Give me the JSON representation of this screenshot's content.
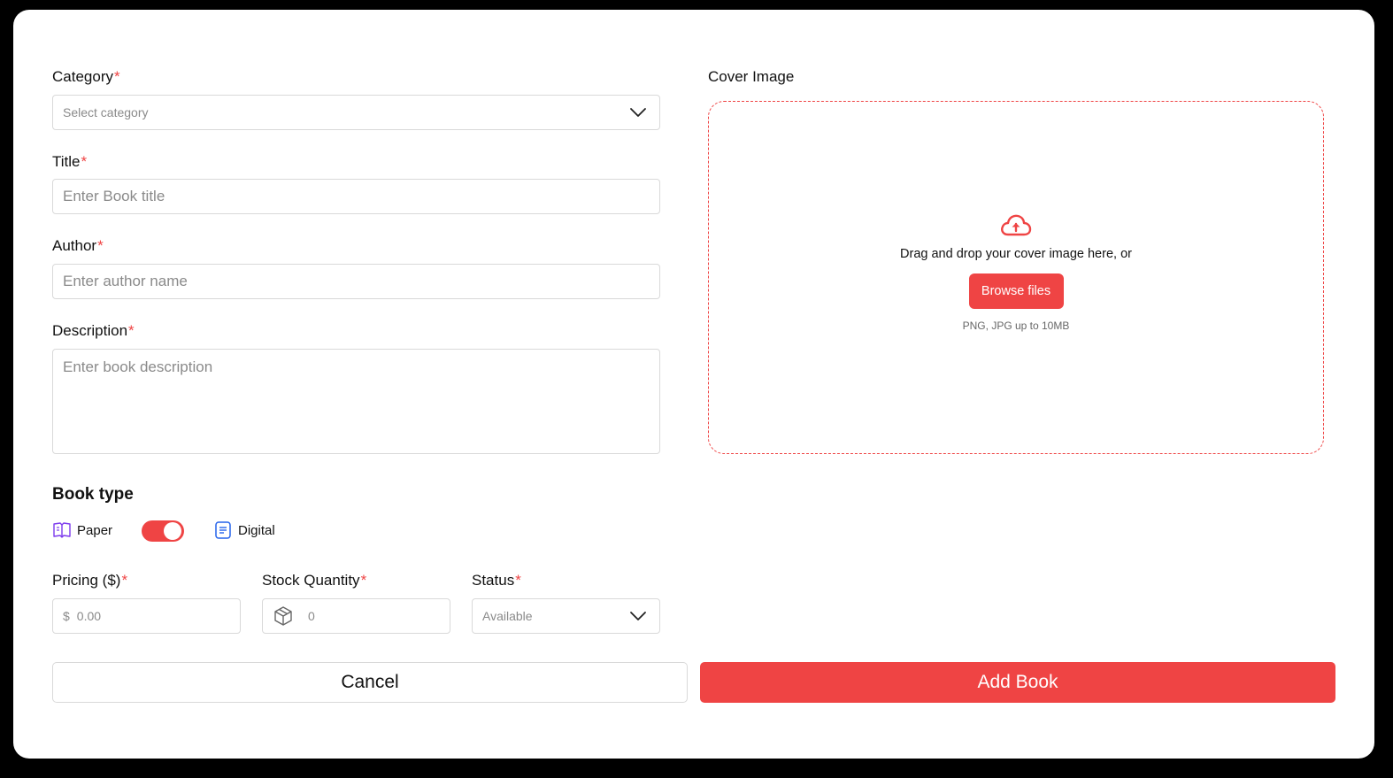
{
  "form": {
    "category": {
      "label": "Category",
      "required": "*",
      "placeholder": "Select category"
    },
    "title": {
      "label": "Title",
      "required": "*",
      "placeholder": "Enter Book title"
    },
    "author": {
      "label": "Author",
      "required": "*",
      "placeholder": "Enter author name"
    },
    "description": {
      "label": "Description",
      "required": "*",
      "placeholder": "Enter book description"
    },
    "book_type": {
      "label": "Book type",
      "paper_label": "Paper",
      "digital_label": "Digital",
      "toggle_on": true
    },
    "pricing": {
      "label": "Pricing ($)",
      "required": "*",
      "prefix": "$",
      "placeholder": "0.00"
    },
    "stock": {
      "label": "Stock Quantity",
      "required": "*",
      "placeholder": "0"
    },
    "status": {
      "label": "Status",
      "required": "*",
      "value": "Available"
    }
  },
  "cover": {
    "label": "Cover Image",
    "drop_text": "Drag and drop your cover image here, or",
    "browse_label": "Browse files",
    "hint": "PNG, JPG up to 10MB"
  },
  "actions": {
    "cancel_label": "Cancel",
    "add_label": "Add Book"
  },
  "colors": {
    "accent": "#ef4444",
    "paper_icon": "#7c3aed",
    "digital_icon": "#2563eb"
  },
  "icons": [
    "chevron-down-icon",
    "cloud-upload-icon",
    "book-open-icon",
    "document-icon",
    "box-icon"
  ]
}
